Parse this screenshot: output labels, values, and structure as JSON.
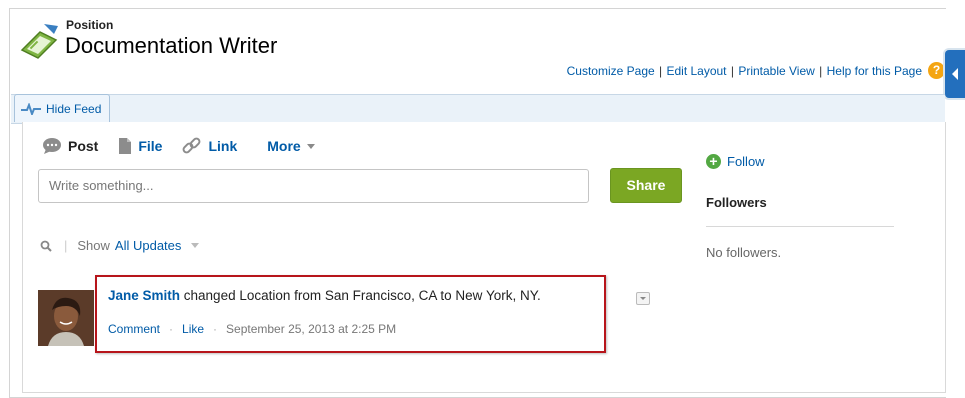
{
  "header": {
    "object_type": "Position",
    "title": "Documentation Writer",
    "links": [
      "Customize Page",
      "Edit Layout",
      "Printable View",
      "Help for this Page"
    ]
  },
  "feed_toggle": {
    "label": "Hide Feed"
  },
  "publisher": {
    "tabs": [
      {
        "label": "Post",
        "icon": "speech-bubble-icon"
      },
      {
        "label": "File",
        "icon": "document-icon"
      },
      {
        "label": "Link",
        "icon": "link-icon"
      }
    ],
    "more_label": "More",
    "input_placeholder": "Write something...",
    "share_label": "Share"
  },
  "filter": {
    "show_label": "Show",
    "value": "All Updates"
  },
  "post": {
    "author": "Jane Smith",
    "text": " changed Location from San Francisco, CA to New York, NY.",
    "comment_label": "Comment",
    "like_label": "Like",
    "timestamp": "September 25, 2013 at 2:25 PM"
  },
  "sidebar": {
    "follow_label": "Follow",
    "followers_heading": "Followers",
    "no_followers": "No followers."
  },
  "colors": {
    "link": "#015ba7",
    "share_button": "#7ba723",
    "highlight_border": "#b7151b",
    "follow_plus": "#53a843"
  }
}
